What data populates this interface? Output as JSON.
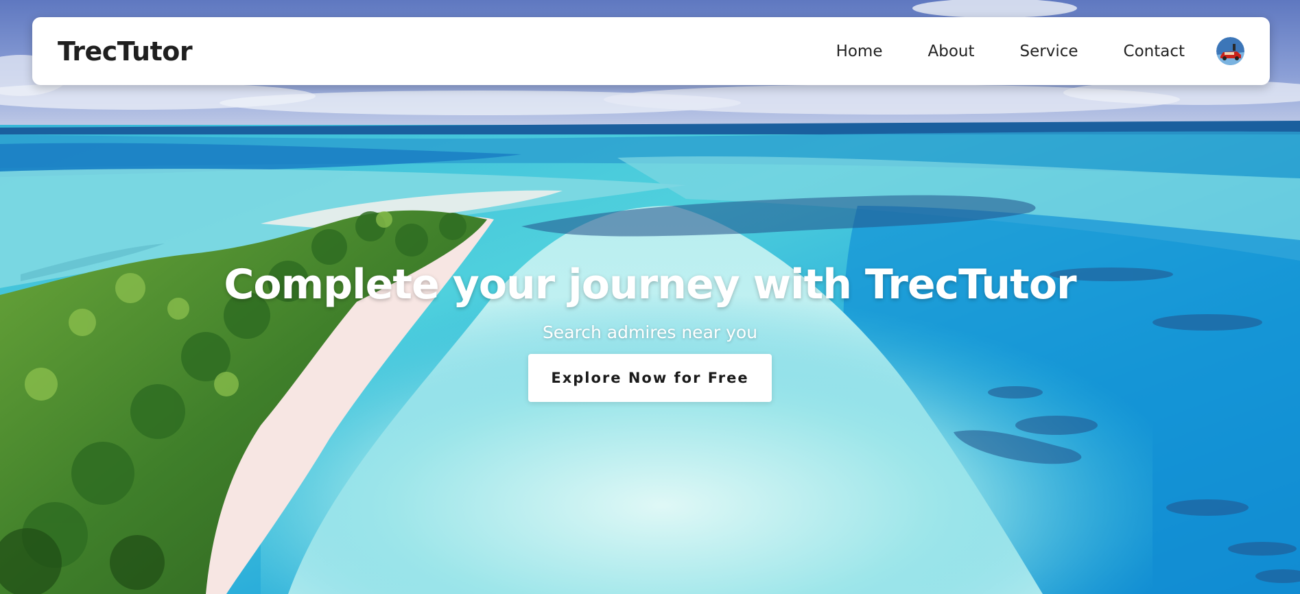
{
  "navbar": {
    "brand": "TrecTutor",
    "links": [
      {
        "label": "Home"
      },
      {
        "label": "About"
      },
      {
        "label": "Service"
      },
      {
        "label": "Contact"
      }
    ],
    "avatar_icon": "user-avatar-icon"
  },
  "hero": {
    "title": "Complete your journey with TrecTutor",
    "subtitle": "Search admires near you",
    "cta_label": "Explore Now for Free",
    "background_icon": "tropical-beach-aerial-photo"
  },
  "colors": {
    "navbar_bg": "#ffffff",
    "brand_text": "#1f1f1f",
    "hero_text": "#ffffff",
    "cta_bg": "#ffffff",
    "cta_text": "#1a1a1a",
    "sky": "#6f86c8",
    "ocean": "#1fb3d6",
    "lagoon": "#8ee3e6",
    "island_green": "#3f7f2a",
    "sand": "#f6e3e0"
  }
}
